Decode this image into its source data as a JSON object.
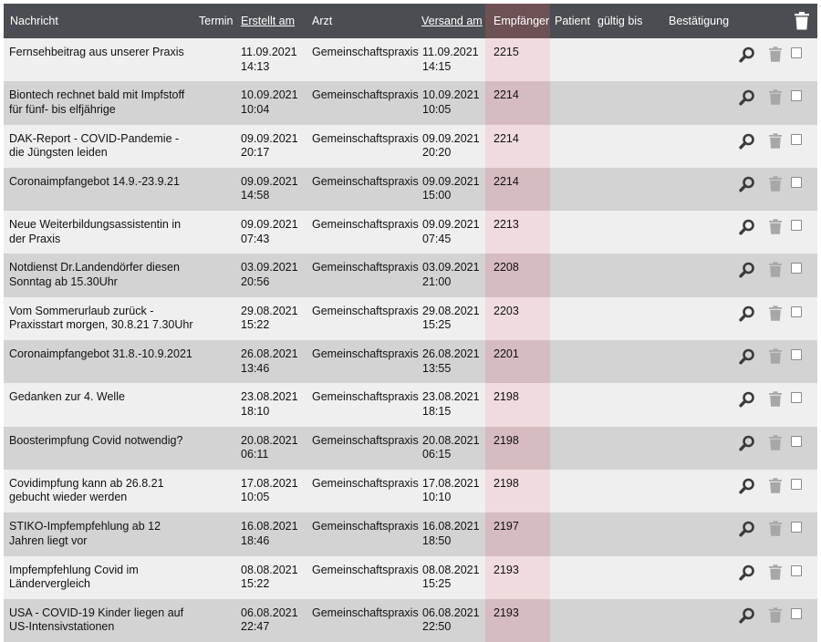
{
  "columns": {
    "nachricht": "Nachricht",
    "termin": "Termin",
    "erstellt": "Erstellt am",
    "arzt": "Arzt",
    "versand": "Versand am",
    "empfaenger": "Empfänger",
    "patient": "Patient",
    "gueltig": "gültig bis",
    "bestaetigung": "Bestätigung"
  },
  "icons": {
    "delete_all": "trash-icon",
    "view": "magnifier-icon",
    "delete": "trash-icon",
    "select": "checkbox"
  },
  "colors": {
    "header_bg": "#4a4e52",
    "row_light": "#efefef",
    "row_dark": "#d3d3d3",
    "highlight_column": "#f0dcdf"
  },
  "rows": [
    {
      "nachricht": "Fernsehbeitrag aus unserer Praxis",
      "erstellt_datum": "11.09.2021",
      "erstellt_zeit": "14:13",
      "arzt": "Gemeinschaftspraxis",
      "versand_datum": "11.09.2021",
      "versand_zeit": "14:15",
      "empfaenger": "2215"
    },
    {
      "nachricht": "Biontech rechnet bald mit Impfstoff für fünf- bis elfjährige",
      "erstellt_datum": "10.09.2021",
      "erstellt_zeit": "10:04",
      "arzt": "Gemeinschaftspraxis",
      "versand_datum": "10.09.2021",
      "versand_zeit": "10:05",
      "empfaenger": "2214"
    },
    {
      "nachricht": "DAK-Report - COVID-Pandemie - die Jüngsten leiden",
      "erstellt_datum": "09.09.2021",
      "erstellt_zeit": "20:17",
      "arzt": "Gemeinschaftspraxis",
      "versand_datum": "09.09.2021",
      "versand_zeit": "20:20",
      "empfaenger": "2214"
    },
    {
      "nachricht": "Coronaimpfangebot 14.9.-23.9.21",
      "erstellt_datum": "09.09.2021",
      "erstellt_zeit": "14:58",
      "arzt": "Gemeinschaftspraxis",
      "versand_datum": "09.09.2021",
      "versand_zeit": "15:00",
      "empfaenger": "2214"
    },
    {
      "nachricht": "Neue Weiterbildungsassistentin in der Praxis",
      "erstellt_datum": "09.09.2021",
      "erstellt_zeit": "07:43",
      "arzt": "Gemeinschaftspraxis",
      "versand_datum": "09.09.2021",
      "versand_zeit": "07:45",
      "empfaenger": "2213"
    },
    {
      "nachricht": "Notdienst Dr.Landendörfer diesen Sonntag ab 15.30Uhr",
      "erstellt_datum": "03.09.2021",
      "erstellt_zeit": "20:56",
      "arzt": "Gemeinschaftspraxis",
      "versand_datum": "03.09.2021",
      "versand_zeit": "21:00",
      "empfaenger": "2208"
    },
    {
      "nachricht": "Vom Sommerurlaub zurück - Praxisstart morgen, 30.8.21 7.30Uhr",
      "erstellt_datum": "29.08.2021",
      "erstellt_zeit": "15:22",
      "arzt": "Gemeinschaftspraxis",
      "versand_datum": "29.08.2021",
      "versand_zeit": "15:25",
      "empfaenger": "2203"
    },
    {
      "nachricht": "Coronaimpfangebot 31.8.-10.9.2021",
      "erstellt_datum": "26.08.2021",
      "erstellt_zeit": "13:46",
      "arzt": "Gemeinschaftspraxis",
      "versand_datum": "26.08.2021",
      "versand_zeit": "13:55",
      "empfaenger": "2201"
    },
    {
      "nachricht": "Gedanken zur 4. Welle",
      "erstellt_datum": "23.08.2021",
      "erstellt_zeit": "18:10",
      "arzt": "Gemeinschaftspraxis",
      "versand_datum": "23.08.2021",
      "versand_zeit": "18:15",
      "empfaenger": "2198"
    },
    {
      "nachricht": "Boosterimpfung Covid notwendig?",
      "erstellt_datum": "20.08.2021",
      "erstellt_zeit": "06:11",
      "arzt": "Gemeinschaftspraxis",
      "versand_datum": "20.08.2021",
      "versand_zeit": "06:15",
      "empfaenger": "2198"
    },
    {
      "nachricht": "Covidimpfung kann ab 26.8.21 gebucht wieder werden",
      "erstellt_datum": "17.08.2021",
      "erstellt_zeit": "10:05",
      "arzt": "Gemeinschaftspraxis",
      "versand_datum": "17.08.2021",
      "versand_zeit": "10:10",
      "empfaenger": "2198"
    },
    {
      "nachricht": "STIKO-Impfempfehlung ab 12 Jahren liegt vor",
      "erstellt_datum": "16.08.2021",
      "erstellt_zeit": "18:46",
      "arzt": "Gemeinschaftspraxis",
      "versand_datum": "16.08.2021",
      "versand_zeit": "18:50",
      "empfaenger": "2197"
    },
    {
      "nachricht": "Impfempfehlung Covid im Ländervergleich",
      "erstellt_datum": "08.08.2021",
      "erstellt_zeit": "15:22",
      "arzt": "Gemeinschaftspraxis",
      "versand_datum": "08.08.2021",
      "versand_zeit": "15:25",
      "empfaenger": "2193"
    },
    {
      "nachricht": "USA - COVID-19 Kinder liegen auf US-Intensivstationen",
      "erstellt_datum": "06.08.2021",
      "erstellt_zeit": "22:47",
      "arzt": "Gemeinschaftspraxis",
      "versand_datum": "06.08.2021",
      "versand_zeit": "22:50",
      "empfaenger": "2193"
    }
  ]
}
